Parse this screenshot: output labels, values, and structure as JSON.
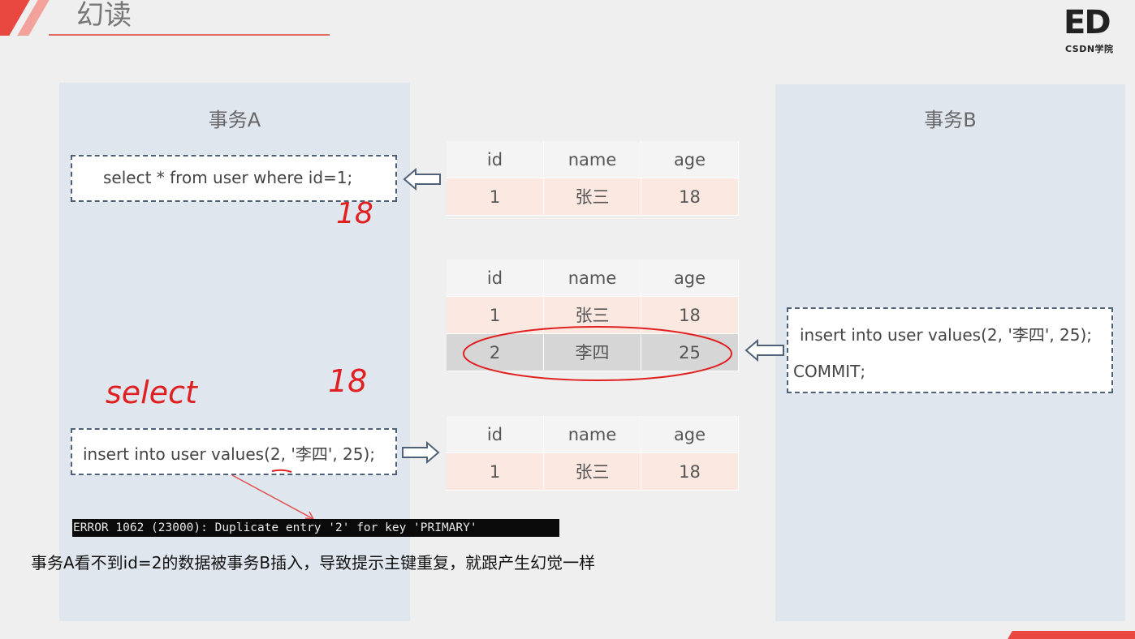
{
  "header": {
    "title": "幻读",
    "logo_main": "ED",
    "logo_sub": "CSDN学院"
  },
  "transaction_a": {
    "title": "事务A",
    "select_sql": "select * from user where id=1;",
    "insert_sql": "insert into user values(2, '李四', 25);"
  },
  "transaction_b": {
    "title": "事务B",
    "insert_sql": "insert into user values(2, '李四', 25);",
    "commit_sql": "COMMIT;"
  },
  "tables": [
    {
      "headers": [
        "id",
        "name",
        "age"
      ],
      "rows": [
        [
          "1",
          "张三",
          "18"
        ]
      ]
    },
    {
      "headers": [
        "id",
        "name",
        "age"
      ],
      "rows": [
        [
          "1",
          "张三",
          "18"
        ],
        [
          "2",
          "李四",
          "25"
        ]
      ]
    },
    {
      "headers": [
        "id",
        "name",
        "age"
      ],
      "rows": [
        [
          "1",
          "张三",
          "18"
        ]
      ]
    }
  ],
  "annotations": {
    "hand_18_top": "18",
    "hand_select": "select",
    "hand_18_mid": "18"
  },
  "error_line": "ERROR 1062 (23000): Duplicate entry '2' for key 'PRIMARY'",
  "caption": "事务A看不到id=2的数据被事务B插入，导致提示主键重复，就跟产生幻觉一样",
  "colors": {
    "accent": "#e8483f",
    "panel_bg": "#dfe6ee",
    "row_pink": "#fbe9e1",
    "row_gray": "#d6d6d6",
    "ink_red": "#e02020"
  }
}
